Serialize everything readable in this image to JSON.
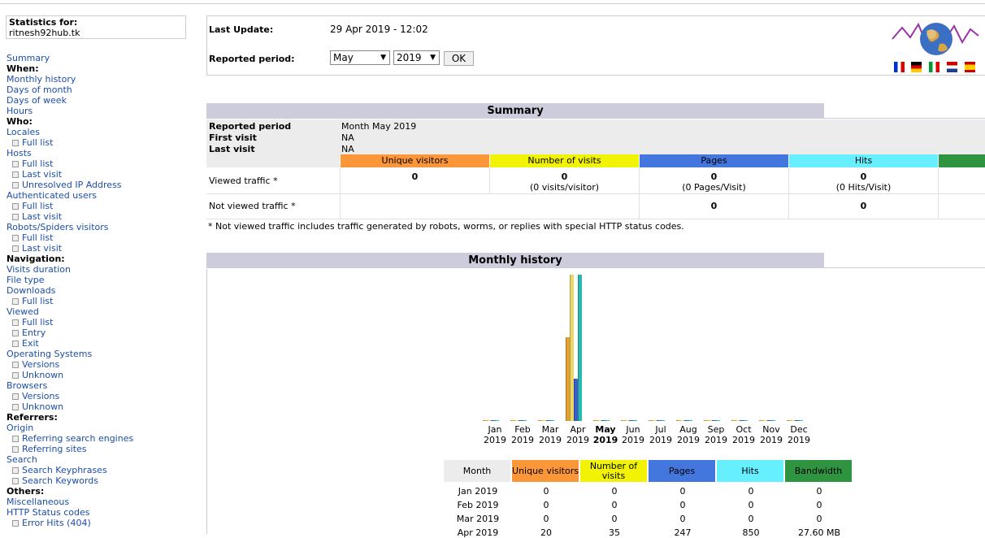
{
  "sidebar": {
    "stats_for_label": "Statistics for:",
    "site_name": "ritnesh92hub.tk",
    "items": [
      {
        "text": "Summary",
        "kind": "link"
      },
      {
        "text": "When:",
        "kind": "header"
      },
      {
        "text": "Monthly history",
        "kind": "link"
      },
      {
        "text": "Days of month",
        "kind": "link"
      },
      {
        "text": "Days of week",
        "kind": "link"
      },
      {
        "text": "Hours",
        "kind": "link"
      },
      {
        "text": "Who:",
        "kind": "header"
      },
      {
        "text": "Locales",
        "kind": "link"
      },
      {
        "text": "Full list",
        "kind": "sub"
      },
      {
        "text": "Hosts",
        "kind": "link"
      },
      {
        "text": "Full list",
        "kind": "sub"
      },
      {
        "text": "Last visit",
        "kind": "sub"
      },
      {
        "text": "Unresolved IP Address",
        "kind": "sub"
      },
      {
        "text": "Authenticated users",
        "kind": "link"
      },
      {
        "text": "Full list",
        "kind": "sub"
      },
      {
        "text": "Last visit",
        "kind": "sub"
      },
      {
        "text": "Robots/Spiders visitors",
        "kind": "link"
      },
      {
        "text": "Full list",
        "kind": "sub"
      },
      {
        "text": "Last visit",
        "kind": "sub"
      },
      {
        "text": "Navigation:",
        "kind": "header"
      },
      {
        "text": "Visits duration",
        "kind": "link"
      },
      {
        "text": "File type",
        "kind": "link"
      },
      {
        "text": "Downloads",
        "kind": "link"
      },
      {
        "text": "Full list",
        "kind": "sub"
      },
      {
        "text": "Viewed",
        "kind": "link"
      },
      {
        "text": "Full list",
        "kind": "sub"
      },
      {
        "text": "Entry",
        "kind": "sub"
      },
      {
        "text": "Exit",
        "kind": "sub"
      },
      {
        "text": "Operating Systems",
        "kind": "link"
      },
      {
        "text": "Versions",
        "kind": "sub"
      },
      {
        "text": "Unknown",
        "kind": "sub"
      },
      {
        "text": "Browsers",
        "kind": "link"
      },
      {
        "text": "Versions",
        "kind": "sub"
      },
      {
        "text": "Unknown",
        "kind": "sub"
      },
      {
        "text": "Referrers:",
        "kind": "header"
      },
      {
        "text": "Origin",
        "kind": "link"
      },
      {
        "text": "Referring search engines",
        "kind": "sub"
      },
      {
        "text": "Referring sites",
        "kind": "sub"
      },
      {
        "text": "Search",
        "kind": "link"
      },
      {
        "text": "Search Keyphrases",
        "kind": "sub"
      },
      {
        "text": "Search Keywords",
        "kind": "sub"
      },
      {
        "text": "Others:",
        "kind": "header"
      },
      {
        "text": "Miscellaneous",
        "kind": "link"
      },
      {
        "text": "HTTP Status codes",
        "kind": "link"
      },
      {
        "text": "Error Hits (404)",
        "kind": "sub"
      }
    ]
  },
  "top": {
    "last_update_label": "Last Update:",
    "last_update_value": "29 Apr 2019 - 12:02",
    "period_label": "Reported period:",
    "month_selected": "May",
    "year_selected": "2019",
    "ok_label": "OK",
    "flags": [
      "french-flag",
      "german-flag",
      "italian-flag",
      "dutch-flag",
      "spanish-flag"
    ]
  },
  "summary": {
    "title": "Summary",
    "reported_period_label": "Reported period",
    "reported_period_value": "Month May 2019",
    "first_visit_label": "First visit",
    "first_visit_value": "NA",
    "last_visit_label": "Last visit",
    "last_visit_value": "NA",
    "columns": [
      "Unique visitors",
      "Number of visits",
      "Pages",
      "Hits"
    ],
    "viewed_label": "Viewed traffic *",
    "viewed": {
      "unique": "0",
      "visits": "0",
      "visits_sub": "(0 visits/visitor)",
      "pages": "0",
      "pages_sub": "(0 Pages/Visit)",
      "hits": "0",
      "hits_sub": "(0 Hits/Visit)"
    },
    "not_viewed_label": "Not viewed traffic *",
    "not_viewed": {
      "pages": "0",
      "hits": "0"
    },
    "footnote": "* Not viewed traffic includes traffic generated by robots, worms, or replies with special HTTP status codes."
  },
  "history": {
    "title": "Monthly history",
    "headers": [
      "Month",
      "Unique visitors",
      "Number of visits",
      "Pages",
      "Hits",
      "Bandwidth"
    ],
    "rows": [
      [
        "Jan 2019",
        "0",
        "0",
        "0",
        "0",
        "0"
      ],
      [
        "Feb 2019",
        "0",
        "0",
        "0",
        "0",
        "0"
      ],
      [
        "Mar 2019",
        "0",
        "0",
        "0",
        "0",
        "0"
      ],
      [
        "Apr 2019",
        "20",
        "35",
        "247",
        "850",
        "27.60 MB"
      ]
    ]
  },
  "chart_data": {
    "type": "bar",
    "categories": [
      "Jan 2019",
      "Feb 2019",
      "Mar 2019",
      "Apr 2019",
      "May 2019",
      "Jun 2019",
      "Jul 2019",
      "Aug 2019",
      "Sep 2019",
      "Oct 2019",
      "Nov 2019",
      "Dec 2019"
    ],
    "month_names": [
      "Jan",
      "Feb",
      "Mar",
      "Apr",
      "May",
      "Jun",
      "Jul",
      "Aug",
      "Sep",
      "Oct",
      "Nov",
      "Dec"
    ],
    "year": "2019",
    "current_index": 4,
    "series": [
      {
        "name": "Unique visitors",
        "values": [
          0,
          0,
          0,
          20,
          0,
          0,
          0,
          0,
          0,
          0,
          0,
          0
        ],
        "color": "#f5a623"
      },
      {
        "name": "Number of visits",
        "values": [
          0,
          0,
          0,
          35,
          0,
          0,
          0,
          0,
          0,
          0,
          0,
          0
        ],
        "color": "#f0e68c"
      },
      {
        "name": "Pages",
        "values": [
          0,
          0,
          0,
          247,
          0,
          0,
          0,
          0,
          0,
          0,
          0,
          0
        ],
        "color": "#4169e1"
      },
      {
        "name": "Hits",
        "values": [
          0,
          0,
          0,
          850,
          0,
          0,
          0,
          0,
          0,
          0,
          0,
          0
        ],
        "color": "#40e0d0"
      },
      {
        "name": "Bandwidth",
        "values": [
          0,
          0,
          0,
          27.6,
          0,
          0,
          0,
          0,
          0,
          0,
          0,
          0
        ],
        "color": "#2e8b57"
      }
    ],
    "colors": {
      "visitors": "#fb9738",
      "visits": "#f2f205",
      "pages": "#4477dd",
      "hits": "#66f0ff",
      "bandwidth": "#2ea040"
    }
  }
}
